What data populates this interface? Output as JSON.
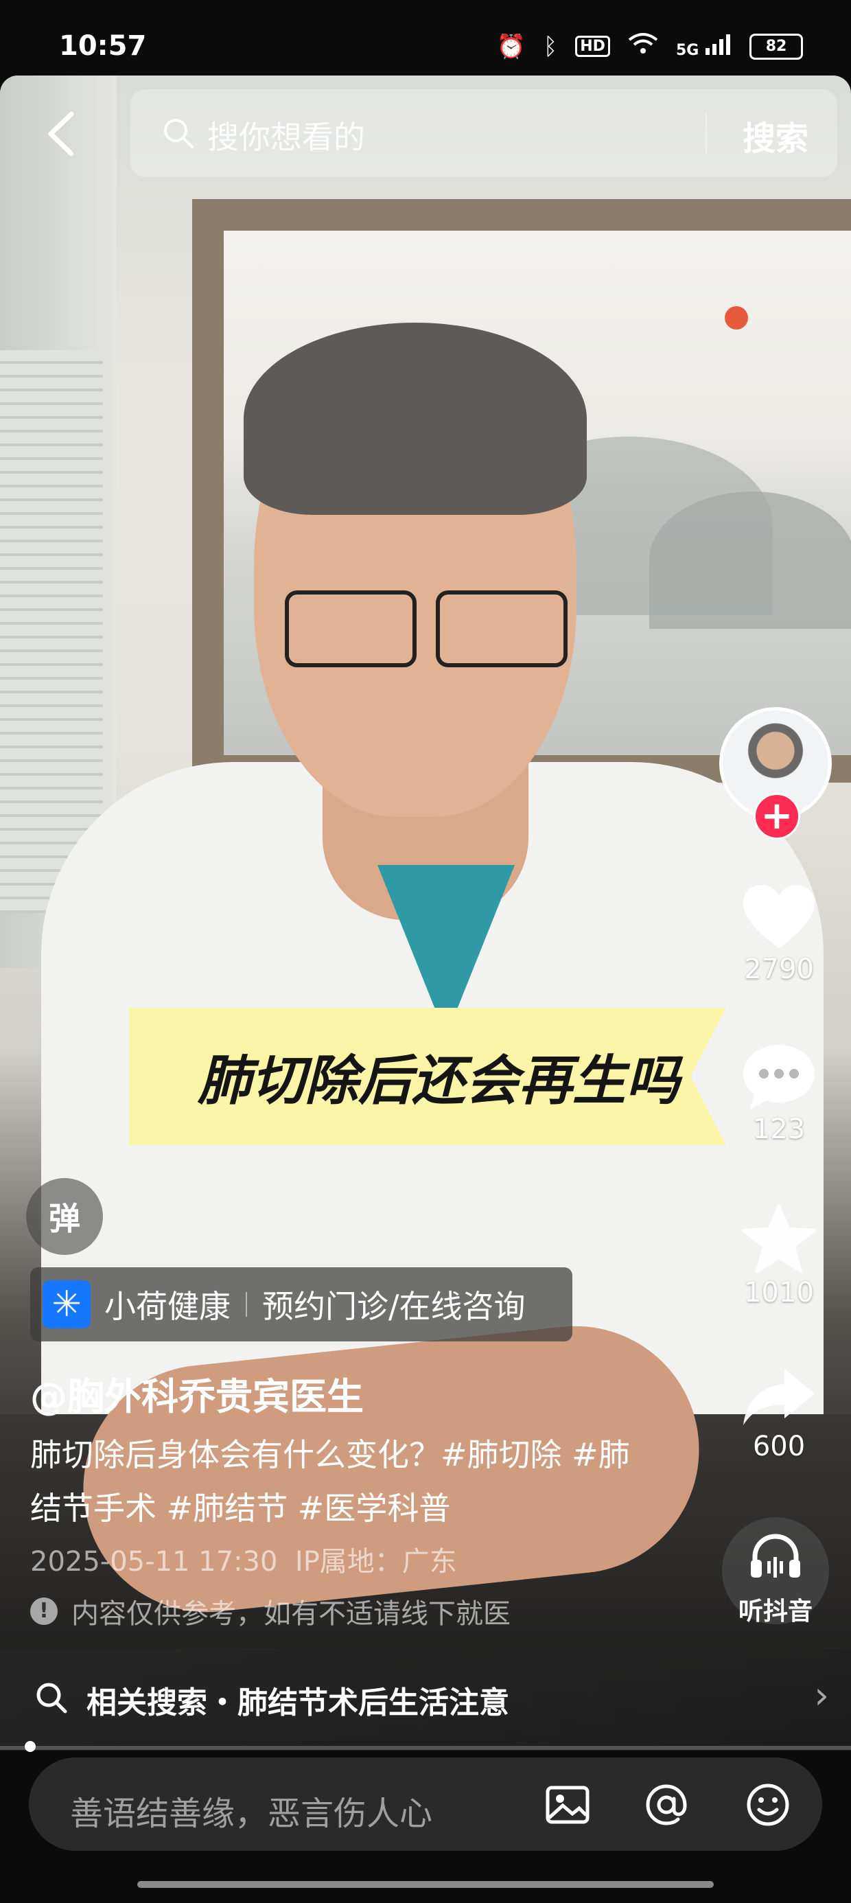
{
  "status_bar": {
    "time": "10:57",
    "network": "5G",
    "battery": "82"
  },
  "search": {
    "placeholder": "搜你想看的",
    "button": "搜索"
  },
  "video": {
    "title_banner": "肺切除后还会再生吗"
  },
  "actions": {
    "likes": "2790",
    "comments": "123",
    "favorites": "1010",
    "shares": "600"
  },
  "danmu": {
    "label": "弹"
  },
  "promo": {
    "name": "小荷健康",
    "link": "预约门诊/在线咨询"
  },
  "post": {
    "author": "@胸外科乔贵宾医生",
    "caption": "肺切除后身体会有什么变化？#肺切除 #肺结节手术 #肺结节 #医学科普",
    "date": "2025-05-11 17:30",
    "ip_location": "IP属地：广东",
    "notice": "内容仅供参考，如有不适请线下就医"
  },
  "listen": {
    "label": "听抖音"
  },
  "related": {
    "label": "相关搜索・肺结节术后生活注意"
  },
  "comment": {
    "placeholder": "善语结善缘，恶言伤人心"
  },
  "progress": {
    "fraction": 0.02
  },
  "icons": [
    "back-icon",
    "search-icon",
    "heart-icon",
    "comment-icon",
    "star-icon",
    "share-icon",
    "headphones-icon",
    "image-icon",
    "at-icon",
    "emoji-icon",
    "chevron-right-icon"
  ]
}
